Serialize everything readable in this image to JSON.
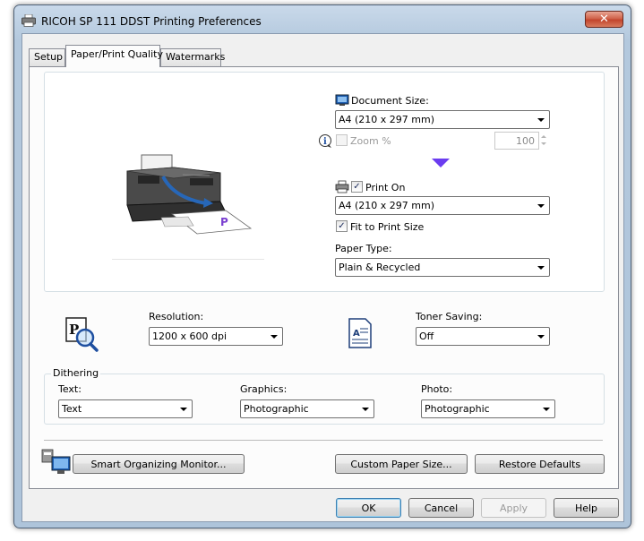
{
  "window": {
    "title": "RICOH SP 111 DDST Printing Preferences",
    "close_label": "✕"
  },
  "tabs": [
    {
      "label": "Setup"
    },
    {
      "label": "Paper/Print Quality"
    },
    {
      "label": "Watermarks"
    }
  ],
  "document_size": {
    "label": "Document Size:",
    "value": "A4 (210 x 297 mm)"
  },
  "zoom": {
    "label": "Zoom %",
    "value": "100",
    "checked": false,
    "enabled": false
  },
  "print_on": {
    "label": "Print On",
    "checked": true,
    "value": "A4 (210 x 297 mm)"
  },
  "fit_to_print_size": {
    "label": "Fit to Print Size",
    "checked": true
  },
  "paper_type": {
    "label": "Paper Type:",
    "value": "Plain & Recycled"
  },
  "resolution": {
    "label": "Resolution:",
    "value": "1200 x 600 dpi"
  },
  "toner_saving": {
    "label": "Toner Saving:",
    "value": "Off"
  },
  "dithering": {
    "label": "Dithering",
    "text": {
      "label": "Text:",
      "value": "Text"
    },
    "graphics": {
      "label": "Graphics:",
      "value": "Photographic"
    },
    "photo": {
      "label": "Photo:",
      "value": "Photographic"
    }
  },
  "buttons": {
    "smart_monitor": "Smart Organizing Monitor...",
    "custom_paper": "Custom Paper Size...",
    "restore": "Restore Defaults",
    "ok": "OK",
    "cancel": "Cancel",
    "apply": "Apply",
    "help": "Help"
  },
  "colors": {
    "accent_arrow": "#6b3cf0",
    "title_close": "#c2452d",
    "default_button_border": "#3c7fb1"
  },
  "icons": [
    "printer-title-icon",
    "document-size-icon",
    "info-icon",
    "print-on-icon",
    "resolution-icon",
    "toner-saving-icon",
    "monitor-icon"
  ]
}
